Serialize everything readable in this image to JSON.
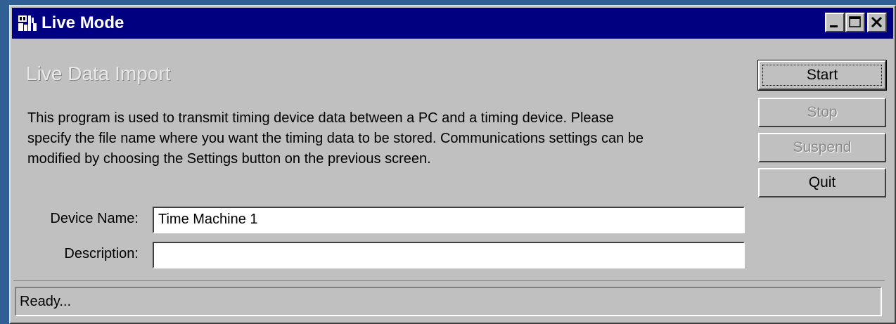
{
  "window": {
    "title": "Live Mode",
    "controls": {
      "minimize_icon": "minimize-icon",
      "maximize_icon": "maximize-icon",
      "close_icon": "close-icon"
    }
  },
  "main": {
    "heading": "Live Data Import",
    "description_lines": [
      "This program is used to transmit timing device data between a PC and a timing device.  Please",
      "specify the file name where you want the timing data to be stored.  Communications settings can be",
      "modified by choosing the Settings button on the previous screen."
    ]
  },
  "buttons": {
    "start": "Start",
    "stop": "Stop",
    "suspend": "Suspend",
    "quit": "Quit"
  },
  "form": {
    "device_name_label": "Device Name:",
    "device_name_value": "Time Machine 1",
    "description_label": "Description:",
    "description_value": ""
  },
  "status": {
    "text": "Ready..."
  },
  "colors": {
    "titlebar": "#000080",
    "face": "#c0c0c0",
    "desktop": "#2f5f93"
  }
}
